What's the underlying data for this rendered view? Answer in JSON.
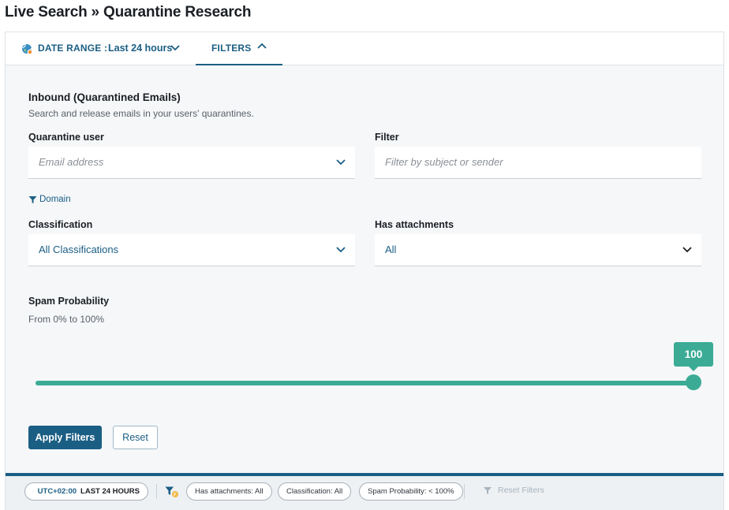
{
  "page": {
    "title": "Live Search » Quarantine Research"
  },
  "topbar": {
    "date_range_label": "DATE RANGE :",
    "date_range_value": "Last 24 hours",
    "filters_tab": "FILTERS"
  },
  "section": {
    "title": "Inbound (Quarantined Emails)",
    "description": "Search and release emails in your users' quarantines."
  },
  "fields": {
    "quarantine_user": {
      "label": "Quarantine user",
      "placeholder": "Email address"
    },
    "filter": {
      "label": "Filter",
      "placeholder": "Filter by subject or sender"
    },
    "domain_link": "Domain",
    "classification": {
      "label": "Classification",
      "value": "All Classifications"
    },
    "has_attachments": {
      "label": "Has attachments",
      "value": "All"
    }
  },
  "spam": {
    "title": "Spam Probability",
    "range": "From 0% to 100%",
    "value_label": "100",
    "value_percent": 100
  },
  "buttons": {
    "apply": "Apply Filters",
    "reset": "Reset"
  },
  "bottombar": {
    "timezone": "UTC+02:00",
    "period": "LAST 24 HOURS",
    "pills": [
      "Has attachments: All",
      "Classification: All",
      "Spam Probability: < 100%"
    ],
    "reset_filters": "Reset Filters"
  },
  "colors": {
    "accent": "#1b5e84",
    "slider": "#3bab95",
    "panel_bg": "#f5f7f9"
  }
}
